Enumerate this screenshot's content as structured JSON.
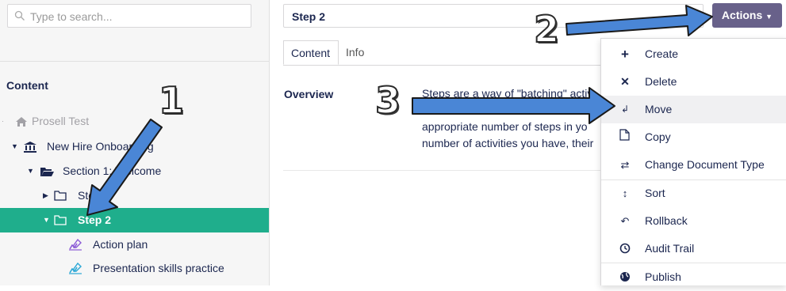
{
  "search": {
    "placeholder": "Type to search..."
  },
  "tree": {
    "heading": "Content",
    "items": [
      {
        "label": "Prosell Test"
      },
      {
        "label": "New Hire Onboarding"
      },
      {
        "label": "Section 1: Welcome"
      },
      {
        "label": "Step 1"
      },
      {
        "label": "Step 2"
      },
      {
        "label": "Action plan"
      },
      {
        "label": "Presentation skills practice"
      }
    ]
  },
  "editor": {
    "name_value": "Step 2",
    "actions_label": "Actions",
    "tabs": [
      {
        "label": "Content"
      },
      {
        "label": "Info"
      }
    ],
    "overview": {
      "label": "Overview",
      "line1": "Steps are a way of \"batching\" activ",
      "line2": "appropriate number of steps in yo",
      "line3": "number of activities you have, their"
    }
  },
  "dropdown": {
    "items": [
      {
        "label": "Create",
        "icon": "plus-icon"
      },
      {
        "label": "Delete",
        "icon": "x-icon"
      },
      {
        "label": "Move",
        "icon": "move-icon"
      },
      {
        "label": "Copy",
        "icon": "copy-icon"
      },
      {
        "label": "Change Document Type",
        "icon": "swap-icon"
      },
      {
        "label": "Sort",
        "icon": "sort-icon"
      },
      {
        "label": "Rollback",
        "icon": "undo-icon"
      },
      {
        "label": "Audit Trail",
        "icon": "clock-icon"
      },
      {
        "label": "Publish",
        "icon": "globe-icon"
      }
    ]
  },
  "annotations": {
    "one": "1",
    "two": "2",
    "three": "3"
  },
  "colors": {
    "accent": "#1fae8c",
    "actions": "#68618a",
    "arrow": "#4a86d6"
  }
}
